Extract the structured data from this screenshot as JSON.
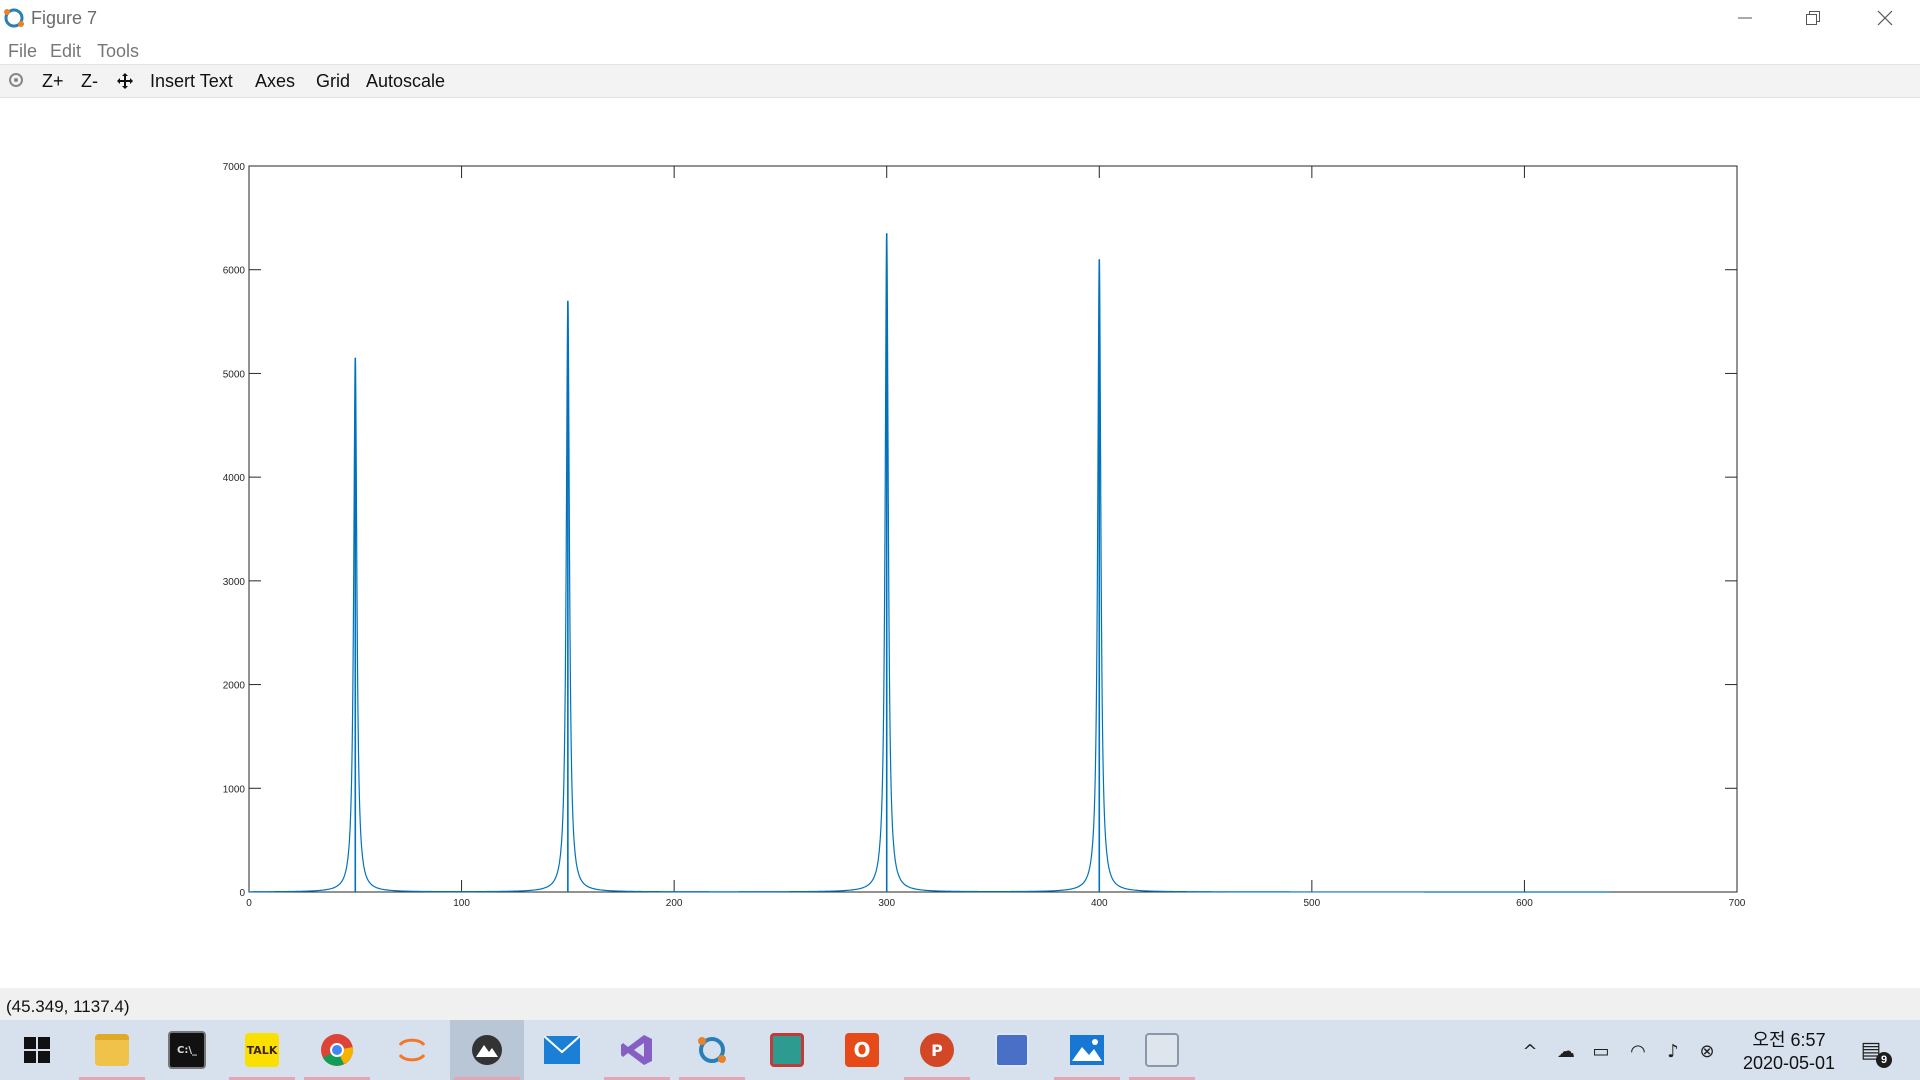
{
  "window": {
    "title": "Figure 7"
  },
  "menu": {
    "items": [
      "File",
      "Edit",
      "Tools"
    ]
  },
  "toolbar": {
    "items": [
      "Z+",
      "Z-",
      "Insert Text",
      "Axes",
      "Grid",
      "Autoscale"
    ]
  },
  "status": {
    "coordinates": "(45.349, 1137.4)"
  },
  "chart_data": {
    "type": "line",
    "title": "",
    "xlabel": "",
    "ylabel": "",
    "xlim": [
      0,
      700
    ],
    "ylim": [
      0,
      7000
    ],
    "xticks": [
      0,
      100,
      200,
      300,
      400,
      500,
      600,
      700
    ],
    "yticks": [
      0,
      1000,
      2000,
      3000,
      4000,
      5000,
      6000,
      7000
    ],
    "grid": false,
    "line_color": "#0072bd",
    "series": [
      {
        "peaks": [
          {
            "x": 50,
            "y": 5150
          },
          {
            "x": 150,
            "y": 5700
          },
          {
            "x": 300,
            "y": 6350
          },
          {
            "x": 400,
            "y": 6100
          }
        ],
        "baseline": 0,
        "x_end": 640
      }
    ]
  },
  "taskbar": {
    "apps": [
      "windows-start",
      "file-explorer",
      "command-prompt",
      "kakaotalk",
      "chrome",
      "jupyter",
      "octave-figure",
      "mail",
      "visual-studio",
      "octave",
      "snipping-tool",
      "office",
      "powerpoint",
      "word-reader",
      "photos",
      "network-monitor"
    ],
    "app_labels": {
      "command-prompt": "C:\\_",
      "kakaotalk": "TALK",
      "office": "O",
      "powerpoint": "P"
    },
    "clock_time": "오전 6:57",
    "clock_date": "2020-05-01",
    "notification_count": "9"
  }
}
